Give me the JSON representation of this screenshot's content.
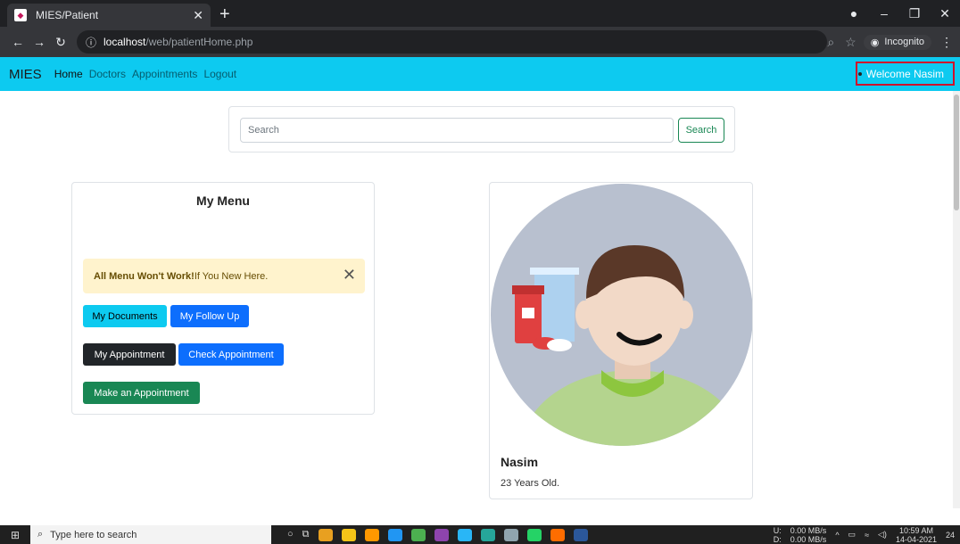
{
  "browser": {
    "tab_title": "MIES/Patient",
    "url_host": "localhost",
    "url_path": "/web/patientHome.php",
    "incognito_label": "Incognito"
  },
  "nav": {
    "brand": "MIES",
    "links": [
      "Home",
      "Doctors",
      "Appointments",
      "Logout"
    ],
    "welcome": "Welcome Nasim"
  },
  "search": {
    "placeholder": "Search",
    "button": "Search"
  },
  "menu": {
    "title": "My Menu",
    "alert_bold": "All Menu Won't Work!",
    "alert_text": "If You New Here.",
    "buttons": [
      "My Documents",
      "My Follow Up",
      "My Appointment",
      "Check Appointment",
      "Make an Appointment"
    ]
  },
  "profile": {
    "name": "Nasim",
    "age": "23 Years Old."
  },
  "taskbar": {
    "search_placeholder": "Type here to search",
    "net_up": "0.00 MB/s",
    "net_down": "0.00 MB/s",
    "net_u": "U:",
    "net_d": "D:",
    "time": "10:59 AM",
    "date": "14-04-2021",
    "notif_count": "24"
  },
  "colors": {
    "navbar": "#0dcaf0",
    "welcome_border": "#d0112b",
    "success": "#198754",
    "primary": "#0d6efd"
  }
}
